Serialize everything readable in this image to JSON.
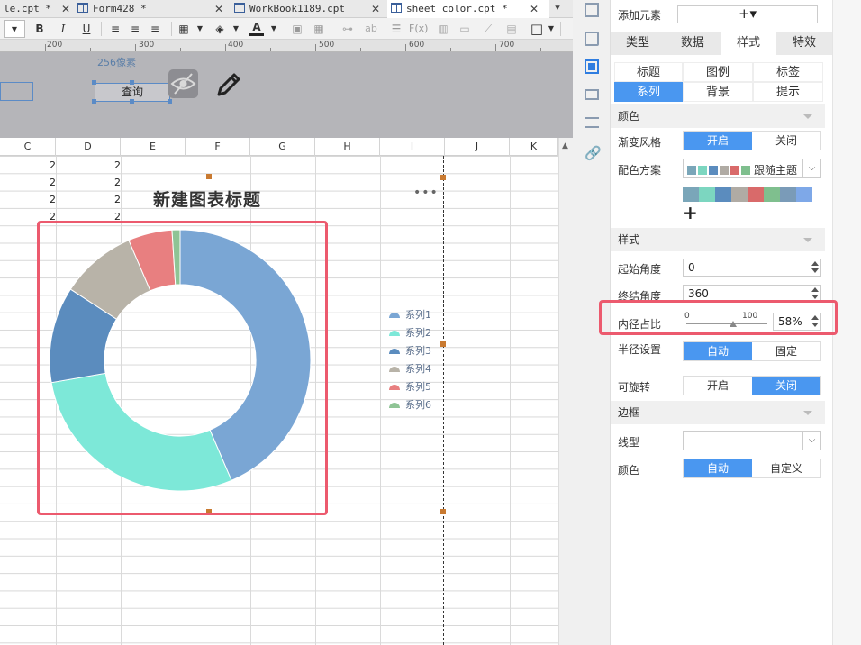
{
  "tabs": [
    {
      "label": "le.cpt *",
      "active": false
    },
    {
      "label": "Form428 *",
      "active": false
    },
    {
      "label": "WorkBook1189.cpt",
      "active": false
    },
    {
      "label": "sheet_color.cpt *",
      "active": true
    }
  ],
  "toolbar": {
    "bold": "B",
    "italic": "I",
    "underline": "U",
    "font_color_letter": "A",
    "formula": "F(x)",
    "ab": "ab"
  },
  "ruler": {
    "labels": [
      "200",
      "300",
      "400",
      "500",
      "600",
      "700"
    ]
  },
  "param": {
    "pixel_label": "256像素",
    "query_button": "查询"
  },
  "columns": [
    "C",
    "D",
    "E",
    "F",
    "G",
    "H",
    "I",
    "J",
    "K"
  ],
  "cell_values": {
    "C": [
      "2",
      "2",
      "2",
      "2"
    ],
    "D": [
      "2",
      "2",
      "2",
      "2"
    ]
  },
  "chart_data": {
    "type": "pie",
    "variant": "donut",
    "title": "新建图表标题",
    "series": [
      {
        "name": "系列1",
        "value": 44.0,
        "color": "#7aa6d4"
      },
      {
        "name": "系列2",
        "value": 29.0,
        "color": "#7de8d8"
      },
      {
        "name": "系列3",
        "value": 12.0,
        "color": "#5b8cbe"
      },
      {
        "name": "系列4",
        "value": 9.5,
        "color": "#b8b3a8"
      },
      {
        "name": "系列5",
        "value": 5.5,
        "color": "#e87f80"
      },
      {
        "name": "系列6",
        "value": 1.0,
        "color": "#8fc495"
      }
    ],
    "start_angle": 0,
    "end_angle": 360,
    "inner_radius_ratio": 0.58,
    "legend_position": "right"
  },
  "chart_more": "•••",
  "panel": {
    "add_element_label": "添加元素",
    "add_element_button": "+▾",
    "top_tabs": [
      {
        "label": "类型",
        "active": false
      },
      {
        "label": "数据",
        "active": false
      },
      {
        "label": "样式",
        "active": true
      },
      {
        "label": "特效",
        "active": false
      }
    ],
    "sub_tabs": [
      {
        "label": "标题",
        "active": false
      },
      {
        "label": "图例",
        "active": false
      },
      {
        "label": "标签",
        "active": false
      },
      {
        "label": "系列",
        "active": true
      },
      {
        "label": "背景",
        "active": false
      },
      {
        "label": "提示",
        "active": false
      }
    ],
    "color_section": "颜色",
    "gradient_label": "渐变风格",
    "gradient_on": "开启",
    "gradient_off": "关闭",
    "scheme_label": "配色方案",
    "scheme_value": "跟随主题",
    "scheme_swatches": [
      "#7aa6b9",
      "#7cd6c0",
      "#5b8cbe",
      "#b0aba4",
      "#d96a6a",
      "#7fbf8e"
    ],
    "palette": [
      "#7aa6b9",
      "#7cd6c0",
      "#5b8cbe",
      "#b0aba4",
      "#d96a6a",
      "#7fbf8e",
      "#7a9bb8",
      "#7ea8e8"
    ],
    "add_color": "+",
    "style_section": "样式",
    "start_angle_label": "起始角度",
    "start_angle_value": "0",
    "end_angle_label": "终结角度",
    "end_angle_value": "360",
    "inner_radius_label": "内径占比",
    "slider_min": "0",
    "slider_max": "100",
    "slider_fraction": 0.58,
    "inner_radius_value": "58%",
    "radius_label": "半径设置",
    "radius_auto": "自动",
    "radius_fixed": "固定",
    "rotate_label": "可旋转",
    "rotate_on": "开启",
    "rotate_off": "关闭",
    "border_section": "边框",
    "line_type_label": "线型",
    "border_color_label": "颜色",
    "border_color_auto": "自动",
    "border_color_custom": "自定义"
  },
  "colors": {
    "accent": "#4a97f0",
    "highlight": "#ec5a6e"
  }
}
